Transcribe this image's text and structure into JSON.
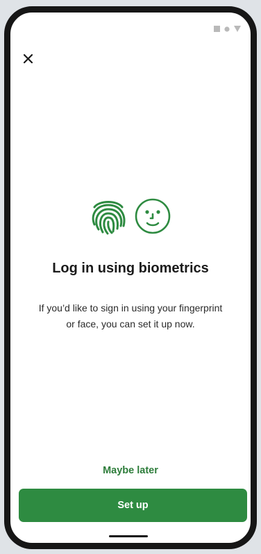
{
  "status_bar": {
    "icons": [
      "signal-icon",
      "wifi-icon",
      "battery-icon"
    ]
  },
  "header": {
    "close_icon": "close-icon"
  },
  "main": {
    "icons": [
      "fingerprint-icon",
      "face-icon"
    ],
    "title": "Log in using biometrics",
    "description_line1": "If you’d like to sign in using your fingerprint",
    "description_line2": "or face, you can set it up now."
  },
  "actions": {
    "maybe_later_label": "Maybe later",
    "setup_label": "Set up"
  },
  "colors": {
    "accent": "#2e8b41",
    "accent_text": "#2e7d3b",
    "frame": "#161616",
    "background": "#dfe3e7"
  }
}
